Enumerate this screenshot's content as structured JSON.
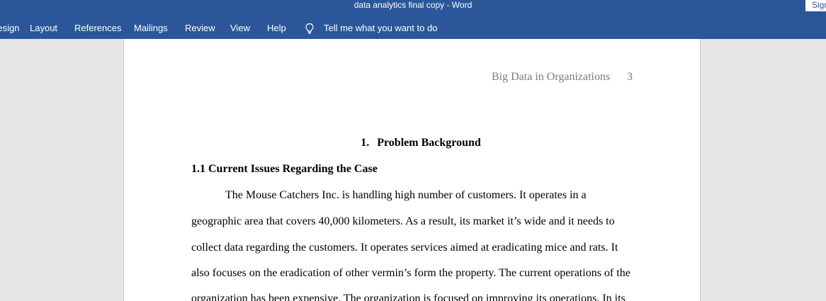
{
  "window": {
    "title": "data analytics final copy  -  Word",
    "signin_label": "Sign in"
  },
  "ribbon": {
    "tabs": [
      "Design",
      "Layout",
      "References",
      "Mailings",
      "Review",
      "View",
      "Help"
    ],
    "tell_me": "Tell me what you want to do"
  },
  "document": {
    "header_title": "Big Data in Organizations",
    "page_number": "3",
    "heading1_number": "1.",
    "heading1_text": "Problem Background",
    "heading2": "1.1 Current Issues Regarding the Case",
    "paragraph_lines": [
      "The Mouse Catchers Inc. is handling high number of customers.  It operates in a",
      "geographic area that covers 40,000 kilometers. As a result, its market it’s wide and it needs to",
      "collect data regarding the customers. It operates services aimed at eradicating mice and rats. It",
      "also focuses on the eradication of other vermin’s form the property. The current operations of the",
      "organization has been expensive. The organization is focused on improving its operations. In its"
    ]
  },
  "colors": {
    "ribbon_blue": "#2b579a",
    "canvas_gray": "#e6e6e6",
    "header_gray": "#7a7a7a"
  }
}
